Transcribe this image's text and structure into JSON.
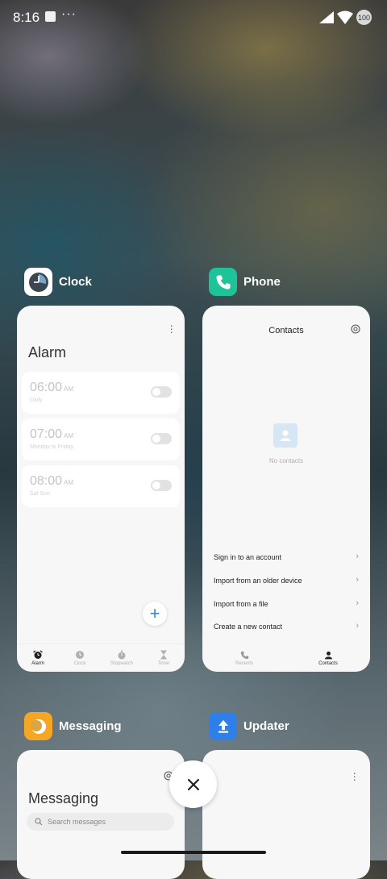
{
  "status_bar": {
    "time": "8:16",
    "dots": "···",
    "battery": "100"
  },
  "recents": {
    "clock": {
      "app_name": "Clock",
      "screen_title": "Alarm",
      "alarms": [
        {
          "time": "06:00",
          "ampm": "AM",
          "repeat": "Daily"
        },
        {
          "time": "07:00",
          "ampm": "AM",
          "repeat": "Monday to Friday"
        },
        {
          "time": "08:00",
          "ampm": "AM",
          "repeat": "Sat Sun"
        }
      ],
      "fab_label": "+",
      "nav": [
        {
          "label": "Alarm",
          "icon": "alarm-icon"
        },
        {
          "label": "Clock",
          "icon": "clock-icon"
        },
        {
          "label": "Stopwatch",
          "icon": "stopwatch-icon"
        },
        {
          "label": "Timer",
          "icon": "hourglass-icon"
        }
      ]
    },
    "phone": {
      "app_name": "Phone",
      "screen_title": "Contacts",
      "empty_text": "No contacts",
      "options": [
        "Sign in to an account",
        "Import from an older device",
        "Import from a file",
        "Create a new contact"
      ],
      "nav": [
        {
          "label": "Recents",
          "icon": "phone-icon"
        },
        {
          "label": "Contacts",
          "icon": "person-icon"
        }
      ]
    },
    "messaging": {
      "app_name": "Messaging",
      "screen_title": "Messaging",
      "search_placeholder": "Search messages"
    },
    "updater": {
      "app_name": "Updater"
    }
  },
  "colors": {
    "phone_icon_bg": "#1fc39a",
    "messaging_icon_bg": "#f5a623",
    "updater_icon_bg": "#2f7fe8",
    "fab_plus": "#3b86d8"
  }
}
